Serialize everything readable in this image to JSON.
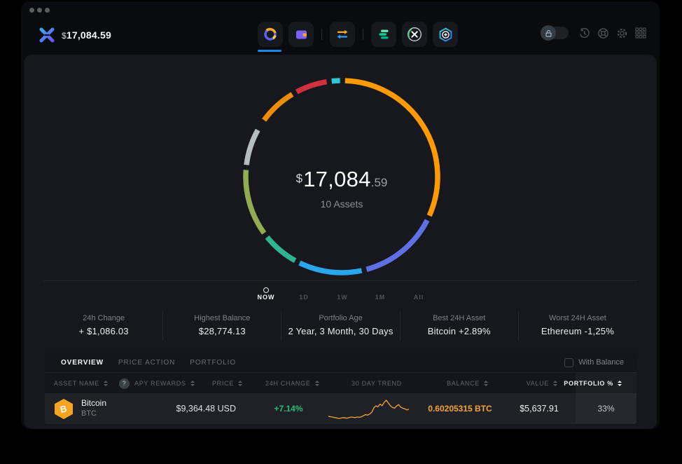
{
  "app": {
    "balance_header_currency": "$",
    "balance_header": "17,084.59"
  },
  "header": {
    "nav_icons": [
      "portfolio",
      "wallet",
      "exchange",
      "compound-app",
      "exodus-x-app",
      "add-app"
    ],
    "right_icons": [
      "privacy-lock-toggle",
      "history",
      "support",
      "settings",
      "apps-grid"
    ]
  },
  "donut_center": {
    "currency": "$",
    "amount": "17,084",
    "cents": ".59",
    "subtitle": "10 Assets"
  },
  "timeline": {
    "options": [
      "NOW",
      "1D",
      "1W",
      "1M",
      "All"
    ],
    "active": "NOW"
  },
  "stats": [
    {
      "label": "24h Change",
      "value": "+ $1,086.03"
    },
    {
      "label": "Highest Balance",
      "value": "$28,774.13"
    },
    {
      "label": "Portfolio Age",
      "value": "2 Year, 3 Month, 30 Days"
    },
    {
      "label": "Best 24H Asset",
      "value": "Bitcoin +2.89%"
    },
    {
      "label": "Worst 24H Asset",
      "value": "Ethereum -1,25%"
    }
  ],
  "table": {
    "tabs": [
      "OVERVIEW",
      "PRICE ACTION",
      "PORTFOLIO"
    ],
    "active_tab": "OVERVIEW",
    "with_balance_label": "With Balance",
    "help_glyph": "?",
    "columns": [
      "ASSET NAME",
      "APY REWARDS",
      "PRICE",
      "24H CHANGE",
      "30 DAY TREND",
      "BALANCE",
      "VALUE",
      "PORTFOLIO %"
    ],
    "rows": [
      {
        "name": "Bitcoin",
        "symbol": "BTC",
        "icon_letter": "B",
        "price": "$9,364.48 USD",
        "change_24h": "+7.14%",
        "balance": "0.60205315 BTC",
        "value": "$5,637.91",
        "portfolio_pct": "33%"
      }
    ]
  },
  "colors": {
    "accent_blue": "#1d86e8",
    "positive_green": "#27bd77",
    "bitcoin_orange": "#f2a433"
  },
  "chart_data": [
    {
      "type": "pie",
      "title": "Portfolio allocation donut",
      "center_total": "$17,084.59",
      "center_subtitle": "10 Assets",
      "legend_position": "none",
      "segments": [
        {
          "name": "asset-cyan",
          "color": "#2fc5d2",
          "start_deg": -6,
          "end_deg": -1
        },
        {
          "name": "asset-bitcoin",
          "color": "#ff9a02",
          "start_deg": 2,
          "end_deg": 114
        },
        {
          "name": "asset-indigo",
          "color": "#5f70e4",
          "start_deg": 117,
          "end_deg": 165
        },
        {
          "name": "asset-skyblue",
          "color": "#2aa7ec",
          "start_deg": 168,
          "end_deg": 206
        },
        {
          "name": "asset-seagreen",
          "color": "#2fb391",
          "start_deg": 209,
          "end_deg": 231
        },
        {
          "name": "asset-olive",
          "color": "#93ab51",
          "start_deg": 234,
          "end_deg": 274
        },
        {
          "name": "asset-silver",
          "color": "#b7bcc2",
          "start_deg": 277,
          "end_deg": 299
        },
        {
          "name": "asset-darkorange",
          "color": "#ef8c07",
          "start_deg": 306,
          "end_deg": 329
        },
        {
          "name": "asset-red",
          "color": "#d1303e",
          "start_deg": 332,
          "end_deg": 351
        }
      ]
    },
    {
      "type": "line",
      "title": "BTC 30 day trend",
      "color": "#f2a433",
      "series": [
        {
          "name": "BTC",
          "values": [
            20,
            18,
            17,
            15,
            14,
            12,
            13,
            15,
            14,
            13,
            15,
            17,
            16,
            15,
            17,
            16,
            18,
            22,
            26,
            24,
            28,
            34,
            50,
            58,
            54,
            64,
            58,
            70,
            78,
            68,
            58,
            52,
            49,
            57,
            62,
            53,
            49,
            47,
            43,
            46
          ]
        }
      ]
    }
  ]
}
